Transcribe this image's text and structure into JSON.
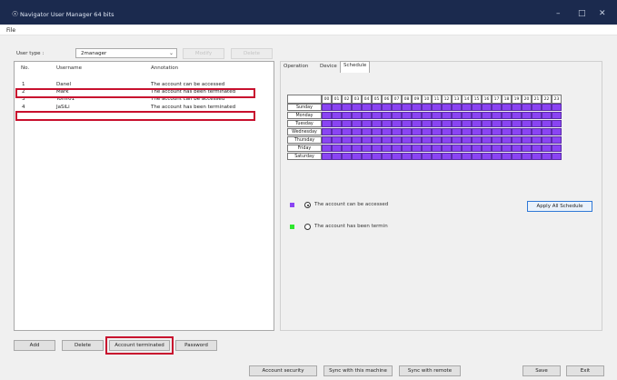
{
  "window": {
    "title": "Navigator User Manager 64 bits"
  },
  "menu": {
    "file": "File"
  },
  "usertype": {
    "label": "User type :",
    "value": "2manager",
    "modify": "Modify",
    "delete": "Delete"
  },
  "list": {
    "headers": {
      "no": "No.",
      "username": "Username",
      "annotation": "Annotation"
    },
    "rows": [
      {
        "no": "1",
        "username": "Danel",
        "annotation": "The account can be accessed"
      },
      {
        "no": "2",
        "username": "Mark",
        "annotation": "The account has been terminated"
      },
      {
        "no": "3",
        "username": "Tomf01",
        "annotation": "The account can be accessed"
      },
      {
        "no": "4",
        "username": "JaSiLi",
        "annotation": "The account has been terminated"
      }
    ]
  },
  "list_buttons": {
    "add": "Add",
    "delete": "Delete",
    "terminated": "Account terminated",
    "password": "Password"
  },
  "tabs": {
    "operation": "Operation",
    "device": "Device",
    "schedule": "Schedule"
  },
  "schedule": {
    "hours": [
      "00",
      "01",
      "02",
      "03",
      "04",
      "05",
      "06",
      "07",
      "08",
      "09",
      "10",
      "11",
      "12",
      "13",
      "14",
      "15",
      "16",
      "17",
      "18",
      "19",
      "20",
      "21",
      "22",
      "23"
    ],
    "days": [
      "Sunday",
      "Monday",
      "Tuesday",
      "Wednesday",
      "Thursday",
      "Friday",
      "Saturday"
    ],
    "color_access": "#8a44f3",
    "color_terminated": "#2ee62e"
  },
  "legend": {
    "access": "The account can be accessed",
    "terminated": "The account has been termin"
  },
  "apply": "Apply All Schedule",
  "bottom": {
    "security": "Account security",
    "sync_machine": "Sync with this machine",
    "sync_remote": "Sync with remote",
    "save": "Save",
    "exit": "Exit"
  }
}
